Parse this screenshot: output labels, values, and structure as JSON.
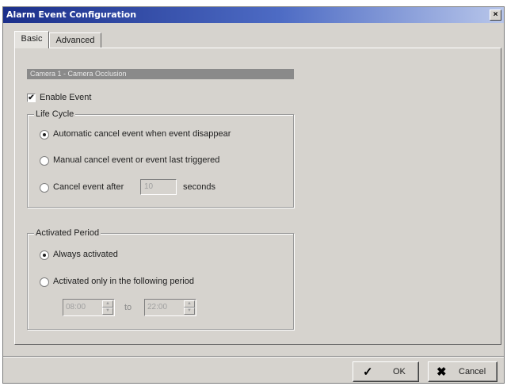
{
  "window": {
    "title": "Alarm Event Configuration",
    "close_glyph": "×"
  },
  "tabs": [
    {
      "label": "Basic",
      "selected": true
    },
    {
      "label": "Advanced",
      "selected": false
    }
  ],
  "camera_header": "Camera 1 - Camera Occlusion",
  "enable_event": {
    "label": "Enable Event",
    "checked": true
  },
  "life_cycle": {
    "title": "Life Cycle",
    "options": [
      {
        "label": "Automatic cancel event when event disappear",
        "selected": true
      },
      {
        "label": "Manual cancel event or event last triggered",
        "selected": false
      },
      {
        "label": "Cancel event after",
        "selected": false
      }
    ],
    "seconds_value": "10",
    "seconds_unit": "seconds"
  },
  "activated_period": {
    "title": "Activated Period",
    "options": [
      {
        "label": "Always activated",
        "selected": true
      },
      {
        "label": "Activated only in the following period",
        "selected": false
      }
    ],
    "start_time": "08:00",
    "to_label": "to",
    "end_time": "22:00"
  },
  "buttons": {
    "ok": "OK",
    "cancel": "Cancel"
  },
  "icons": {
    "ok": "checkmark-icon",
    "cancel": "x-mark-icon",
    "check": "✔",
    "ok_glyph": "✓",
    "cancel_glyph": "✖",
    "spin_up": "▲",
    "spin_down": "▼"
  }
}
